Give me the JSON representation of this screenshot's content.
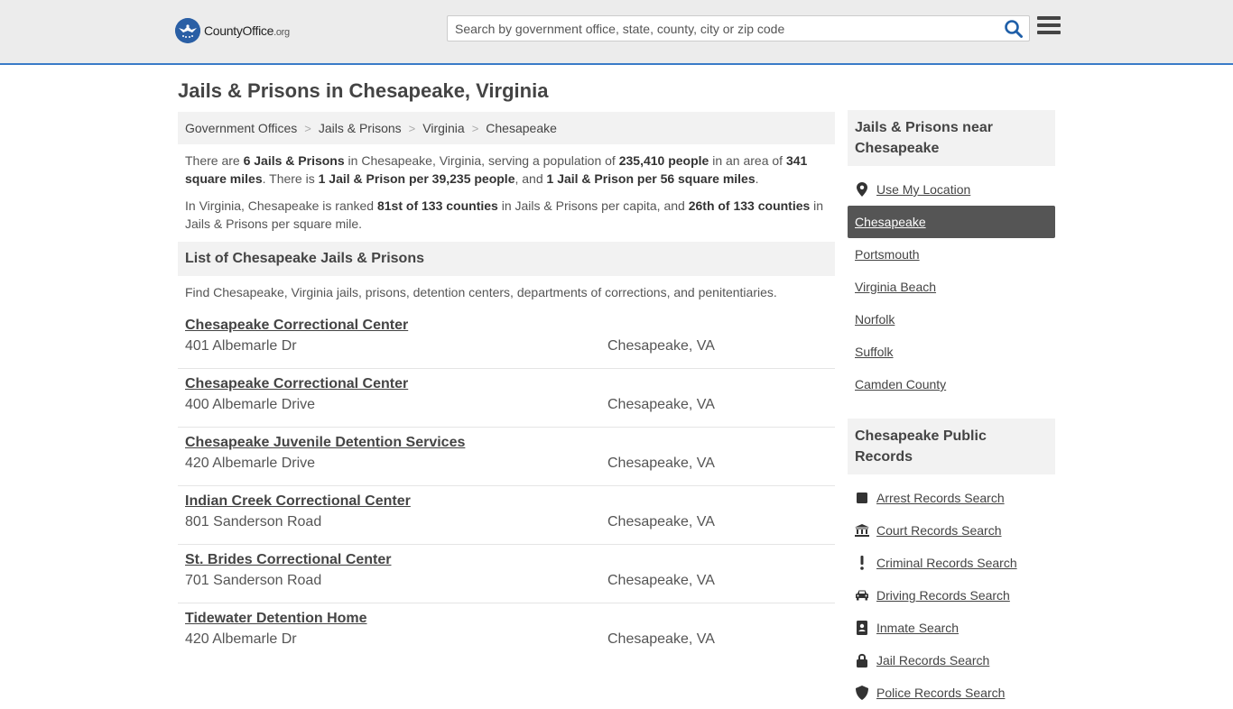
{
  "header": {
    "logo_text_main": "CountyOffice",
    "logo_text_suffix": ".org",
    "search_placeholder": "Search by government office, state, county, city or zip code",
    "search_value": ""
  },
  "page_title": "Jails & Prisons in Chesapeake, Virginia",
  "breadcrumb": [
    {
      "label": "Government Offices"
    },
    {
      "label": "Jails & Prisons"
    },
    {
      "label": "Virginia"
    },
    {
      "label": "Chesapeake"
    }
  ],
  "breadcrumb_separator": ">",
  "intro": {
    "p1": {
      "t1": "There are ",
      "b1": "6 Jails & Prisons",
      "t2": " in Chesapeake, Virginia, serving a population of ",
      "b2": "235,410 people",
      "t3": " in an area of ",
      "b3": "341 square miles",
      "t4": ". There is ",
      "b4": "1 Jail & Prison per 39,235 people",
      "t5": ", and ",
      "b5": "1 Jail & Prison per 56 square miles",
      "t6": "."
    },
    "p2": {
      "t1": "In Virginia, Chesapeake is ranked ",
      "b1": "81st of 133 counties",
      "t2": " in Jails & Prisons per capita, and ",
      "b2": "26th of 133 counties",
      "t3": " in Jails & Prisons per square mile."
    }
  },
  "list": {
    "heading": "List of Chesapeake Jails & Prisons",
    "description": "Find Chesapeake, Virginia jails, prisons, detention centers, departments of corrections, and penitentiaries.",
    "items": [
      {
        "name": "Chesapeake Correctional Center",
        "address": "401 Albemarle Dr",
        "city": "Chesapeake, VA"
      },
      {
        "name": "Chesapeake Correctional Center",
        "address": "400 Albemarle Drive",
        "city": "Chesapeake, VA"
      },
      {
        "name": "Chesapeake Juvenile Detention Services",
        "address": "420 Albemarle Drive",
        "city": "Chesapeake, VA"
      },
      {
        "name": "Indian Creek Correctional Center",
        "address": "801 Sanderson Road",
        "city": "Chesapeake, VA"
      },
      {
        "name": "St. Brides Correctional Center",
        "address": "701 Sanderson Road",
        "city": "Chesapeake, VA"
      },
      {
        "name": "Tidewater Detention Home",
        "address": "420 Albemarle Dr",
        "city": "Chesapeake, VA"
      }
    ]
  },
  "sidebar": {
    "nearby_heading": "Jails & Prisons near Chesapeake",
    "nearby_items": [
      {
        "label": "Use My Location",
        "icon": "map-marker-icon",
        "active": false
      },
      {
        "label": "Chesapeake",
        "icon": "",
        "active": true
      },
      {
        "label": "Portsmouth",
        "icon": "",
        "active": false
      },
      {
        "label": "Virginia Beach",
        "icon": "",
        "active": false
      },
      {
        "label": "Norfolk",
        "icon": "",
        "active": false
      },
      {
        "label": "Suffolk",
        "icon": "",
        "active": false
      },
      {
        "label": "Camden County",
        "icon": "",
        "active": false
      }
    ],
    "records_heading": "Chesapeake Public Records",
    "records_items": [
      {
        "label": "Arrest Records Search",
        "icon": "square-icon"
      },
      {
        "label": "Court Records Search",
        "icon": "courthouse-icon"
      },
      {
        "label": "Criminal Records Search",
        "icon": "exclamation-icon"
      },
      {
        "label": "Driving Records Search",
        "icon": "car-icon"
      },
      {
        "label": "Inmate Search",
        "icon": "id-badge-icon"
      },
      {
        "label": "Jail Records Search",
        "icon": "lock-icon"
      },
      {
        "label": "Police Records Search",
        "icon": "shield-icon"
      }
    ]
  }
}
